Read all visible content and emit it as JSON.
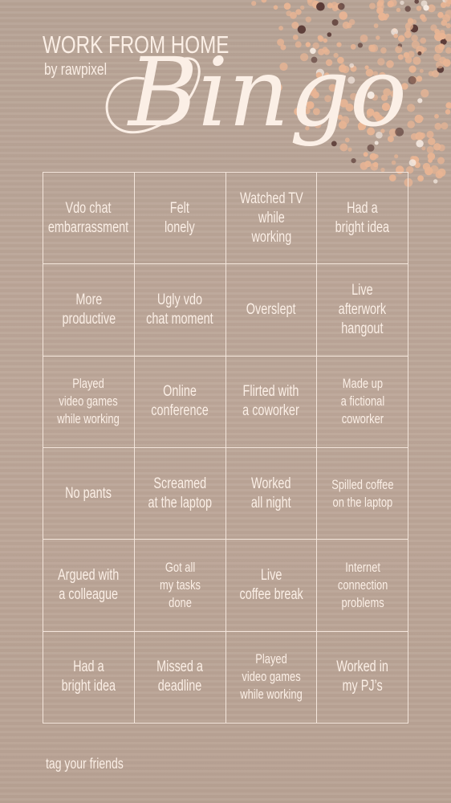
{
  "header": {
    "title": "WORK FROM HOME",
    "subtitle": "by rawpixel",
    "script_title": "Bingo"
  },
  "colors": {
    "background": "#b9a294",
    "text": "#fbefe6",
    "grid_lines": "#f4e6dc",
    "confetti_light": "#e9b594",
    "confetti_dark": "#5a3a36"
  },
  "board": {
    "rows": [
      [
        "Vdo chat\nembarrassment",
        "Felt\nlonely",
        "Watched TV\nwhile working",
        "Had a\nbright idea"
      ],
      [
        "More\nproductive",
        "Ugly vdo\nchat moment",
        "Overslept",
        "Live afterwork\nhangout"
      ],
      [
        "Played\nvideo games\nwhile working",
        "Online\nconference",
        "Flirted with\na coworker",
        "Made up\na fictional\ncoworker"
      ],
      [
        "No pants",
        "Screamed\nat the laptop",
        "Worked\nall night",
        "Spilled coffee\non the laptop"
      ],
      [
        "Argued with\na colleague",
        "Got all\nmy tasks\ndone",
        "Live\ncoffee break",
        "Internet\nconnection\nproblems"
      ],
      [
        "Had a\nbright idea",
        "Missed a\ndeadline",
        "Played\nvideo games\nwhile working",
        "Worked in\nmy PJ’s"
      ]
    ]
  },
  "footer": {
    "text": "tag your friends"
  }
}
